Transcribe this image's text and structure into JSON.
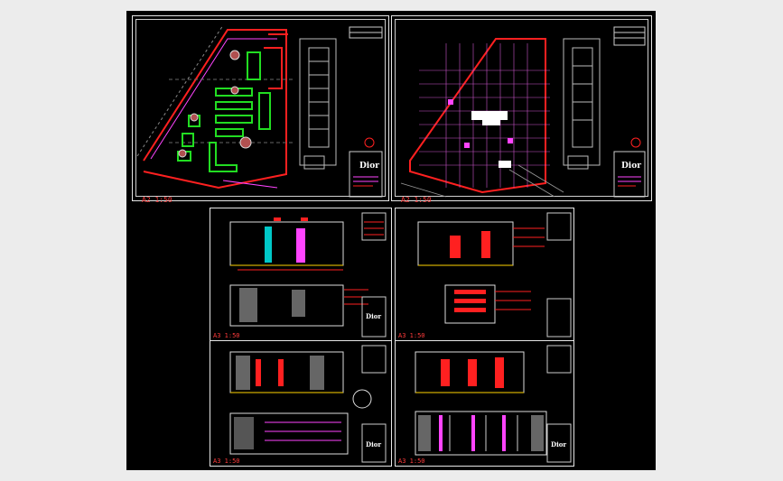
{
  "sheets": {
    "plan_left": {
      "scale_label": "A2  1:50",
      "logo": "Dior"
    },
    "plan_right": {
      "scale_label": "A2  1:50",
      "logo": "Dior"
    },
    "elev_tl": {
      "scale_label": "A3  1:50",
      "logo": "Dior"
    },
    "elev_tr": {
      "scale_label": "A3  1:50",
      "logo": ""
    },
    "elev_bl": {
      "scale_label": "A3  1:50",
      "logo": "Dior"
    },
    "elev_br": {
      "scale_label": "A3  1:50",
      "logo": "Dior"
    }
  },
  "colors": {
    "background": "#000000",
    "frame": "#e6e6e6",
    "walls": "#ff2020",
    "fixtures": "#22dd22",
    "accent": "#ff44ff",
    "dims": "#ffd400"
  }
}
